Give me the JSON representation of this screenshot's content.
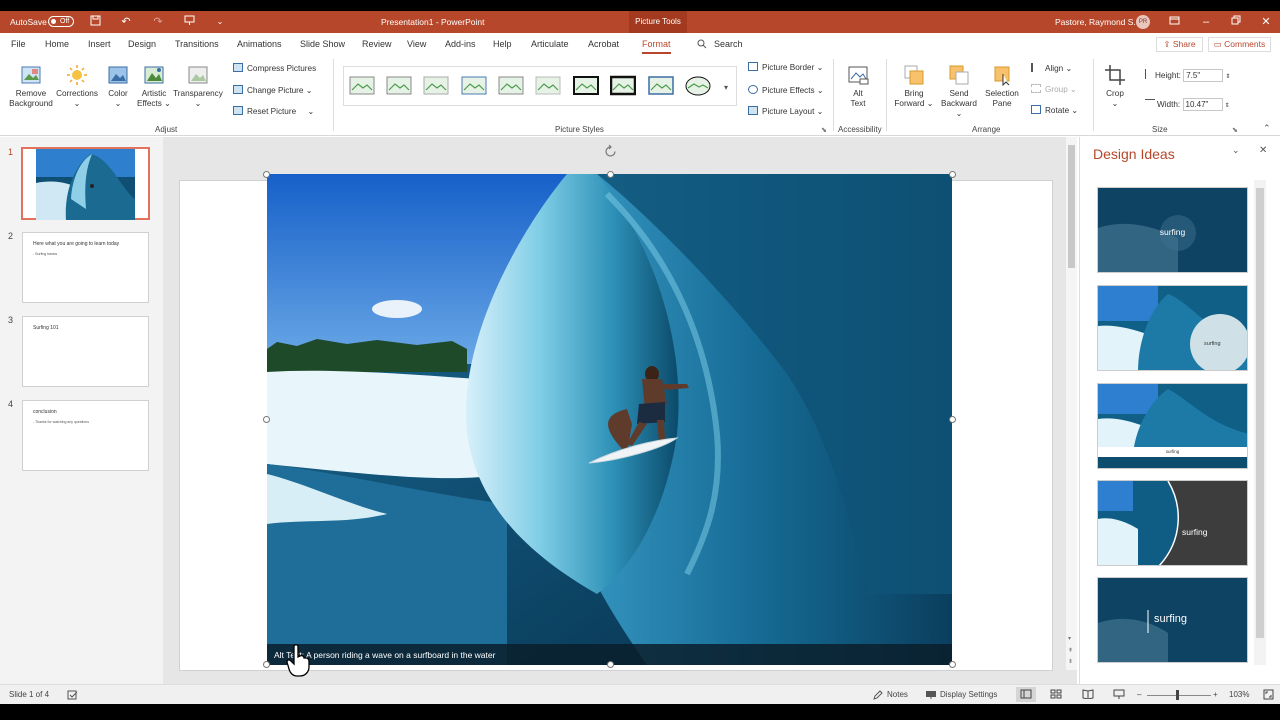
{
  "titlebar": {
    "autosave_label": "AutoSave",
    "autosave_state": "Off",
    "document_title": "Presentation1  -  PowerPoint",
    "contextual_tab": "Picture Tools",
    "user_name": "Pastore, Raymond S.",
    "user_initials": "PR",
    "accent_color": "#b7472a"
  },
  "menu": {
    "file": "File",
    "home": "Home",
    "insert": "Insert",
    "design": "Design",
    "transitions": "Transitions",
    "animations": "Animations",
    "slideshow": "Slide Show",
    "review": "Review",
    "view": "View",
    "addins": "Add-ins",
    "help": "Help",
    "articulate": "Articulate",
    "acrobat": "Acrobat",
    "format": "Format",
    "search": "Search",
    "share": "Share",
    "comments": "Comments"
  },
  "ribbon": {
    "remove_background": [
      "Remove",
      "Background"
    ],
    "corrections": "Corrections",
    "color": "Color",
    "artistic_effects": [
      "Artistic",
      "Effects"
    ],
    "transparency": "Transparency",
    "compress_pictures": "Compress Pictures",
    "change_picture": "Change Picture",
    "reset_picture": "Reset Picture",
    "group_adjust": "Adjust",
    "picture_border": "Picture Border",
    "picture_effects": "Picture Effects",
    "picture_layout": "Picture Layout",
    "group_picture_styles": "Picture Styles",
    "alt_text": [
      "Alt",
      "Text"
    ],
    "group_accessibility": "Accessibility",
    "bring_forward": [
      "Bring",
      "Forward"
    ],
    "send_backward": [
      "Send",
      "Backward"
    ],
    "selection_pane": [
      "Selection",
      "Pane"
    ],
    "align": "Align",
    "group": "Group",
    "rotate": "Rotate",
    "group_arrange": "Arrange",
    "crop": "Crop",
    "height_label": "Height:",
    "height_value": "7.5\"",
    "width_label": "Width:",
    "width_value": "10.47\"",
    "group_size": "Size"
  },
  "slides": [
    {
      "number": "1",
      "title": "",
      "bullet": ""
    },
    {
      "number": "2",
      "title": "Here what you are going to learn today",
      "bullet": "- Surfing basics"
    },
    {
      "number": "3",
      "title": "Surfing 101",
      "bullet": ""
    },
    {
      "number": "4",
      "title": "conclusion",
      "bullet": "- Thanks for watching any questions"
    }
  ],
  "canvas": {
    "alt_text_caption": "Alt Text: A person riding a wave on a surfboard in the water"
  },
  "design_ideas": {
    "title": "Design Ideas",
    "cards": [
      "surfing",
      "surfing",
      "surfing",
      "surfing",
      "surfing"
    ]
  },
  "status": {
    "slide_indicator": "Slide 1 of 4",
    "notes": "Notes",
    "display_settings": "Display Settings",
    "zoom": "103%"
  }
}
